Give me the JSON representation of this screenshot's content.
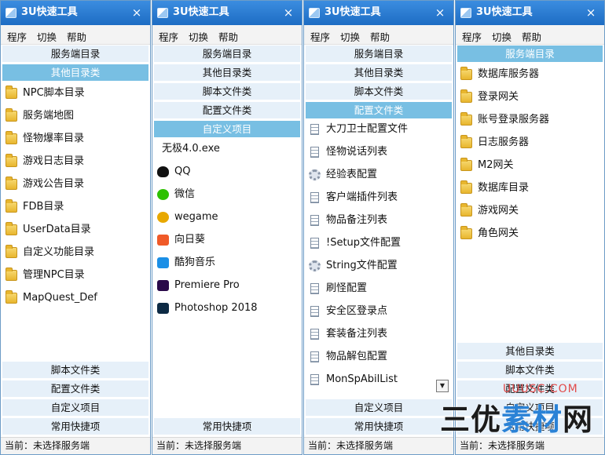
{
  "windows": [
    {
      "title": "3U快速工具",
      "close": "×",
      "menu": [
        "程序",
        "切换",
        "帮助"
      ],
      "top_groups": [
        {
          "label": "服务端目录",
          "active": false
        },
        {
          "label": "其他目录类",
          "active": true
        }
      ],
      "items": [
        {
          "icon": "folder-icon",
          "label": "NPC脚本目录"
        },
        {
          "icon": "folder-icon",
          "label": "服务端地图"
        },
        {
          "icon": "folder-icon",
          "label": "怪物爆率目录"
        },
        {
          "icon": "folder-icon",
          "label": "游戏日志目录"
        },
        {
          "icon": "folder-icon",
          "label": "游戏公告目录"
        },
        {
          "icon": "folder-icon",
          "label": "FDB目录"
        },
        {
          "icon": "folder-icon",
          "label": "UserData目录"
        },
        {
          "icon": "folder-icon",
          "label": "自定义功能目录"
        },
        {
          "icon": "folder-icon",
          "label": "管理NPC目录"
        },
        {
          "icon": "folder-icon",
          "label": "MapQuest_Def"
        }
      ],
      "bottom_groups": [
        {
          "label": "脚本文件类"
        },
        {
          "label": "配置文件类"
        },
        {
          "label": "自定义项目"
        },
        {
          "label": "常用快捷项"
        }
      ],
      "status": "当前：未选择服务端"
    },
    {
      "title": "3U快速工具",
      "close": "×",
      "menu": [
        "程序",
        "切换",
        "帮助"
      ],
      "top_groups": [
        {
          "label": "服务端目录",
          "active": false
        },
        {
          "label": "其他目录类",
          "active": false
        },
        {
          "label": "脚本文件类",
          "active": false
        },
        {
          "label": "配置文件类",
          "active": false
        },
        {
          "label": "自定义项目",
          "active": true
        }
      ],
      "items": [
        {
          "icon": "none",
          "label": "无极4.0.exe"
        },
        {
          "icon": "qq-icon",
          "label": "QQ"
        },
        {
          "icon": "wechat-icon",
          "label": "微信"
        },
        {
          "icon": "wegame-icon",
          "label": "wegame"
        },
        {
          "icon": "sunflower-icon",
          "label": "向日葵"
        },
        {
          "icon": "kugou-icon",
          "label": "酷狗音乐"
        },
        {
          "icon": "premiere-icon",
          "label": "Premiere Pro"
        },
        {
          "icon": "photoshop-icon",
          "label": "Photoshop 2018"
        }
      ],
      "bottom_groups": [
        {
          "label": "常用快捷项"
        }
      ],
      "status": "当前：未选择服务端"
    },
    {
      "title": "3U快速工具",
      "close": "×",
      "menu": [
        "程序",
        "切换",
        "帮助"
      ],
      "top_groups": [
        {
          "label": "服务端目录",
          "active": false
        },
        {
          "label": "其他目录类",
          "active": false
        },
        {
          "label": "脚本文件类",
          "active": false
        },
        {
          "label": "配置文件类",
          "active": true
        }
      ],
      "items": [
        {
          "icon": "document-icon",
          "label": "大刀卫士配置文件"
        },
        {
          "icon": "document-icon",
          "label": "怪物说话列表"
        },
        {
          "icon": "gear-icon",
          "label": "经验表配置"
        },
        {
          "icon": "document-icon",
          "label": "客户端插件列表"
        },
        {
          "icon": "document-icon",
          "label": "物品备注列表"
        },
        {
          "icon": "document-icon",
          "label": "!Setup文件配置"
        },
        {
          "icon": "gear-icon",
          "label": "String文件配置"
        },
        {
          "icon": "document-icon",
          "label": "刷怪配置"
        },
        {
          "icon": "document-icon",
          "label": "安全区登录点"
        },
        {
          "icon": "document-icon",
          "label": "套装备注列表"
        },
        {
          "icon": "document-icon",
          "label": "物品解包配置"
        },
        {
          "icon": "document-icon",
          "label": "MonSpAbilList"
        }
      ],
      "scroll_down": "▼",
      "bottom_groups": [
        {
          "label": "自定义项目"
        },
        {
          "label": "常用快捷项"
        }
      ],
      "status": "当前：未选择服务端"
    },
    {
      "title": "3U快速工具",
      "close": "×",
      "menu": [
        "程序",
        "切换",
        "帮助"
      ],
      "top_groups": [
        {
          "label": "服务端目录",
          "active": true
        }
      ],
      "items": [
        {
          "icon": "folder-icon",
          "label": "数据库服务器"
        },
        {
          "icon": "folder-icon",
          "label": "登录网关"
        },
        {
          "icon": "folder-icon",
          "label": "账号登录服务器"
        },
        {
          "icon": "folder-icon",
          "label": "日志服务器"
        },
        {
          "icon": "folder-icon",
          "label": "M2网关"
        },
        {
          "icon": "folder-icon",
          "label": "数据库目录"
        },
        {
          "icon": "folder-icon",
          "label": "游戏网关"
        },
        {
          "icon": "folder-icon",
          "label": "角色网关"
        }
      ],
      "bottom_groups": [
        {
          "label": "其他目录类"
        },
        {
          "label": "脚本文件类"
        },
        {
          "label": "配置文件类"
        },
        {
          "label": "自定义项目"
        },
        {
          "label": "常用快捷项"
        }
      ],
      "status": "当前：未选择服务端"
    }
  ],
  "watermark": {
    "left": "三优",
    "mid": "素材",
    "right": "网",
    "url": "UUUSC.COM"
  }
}
